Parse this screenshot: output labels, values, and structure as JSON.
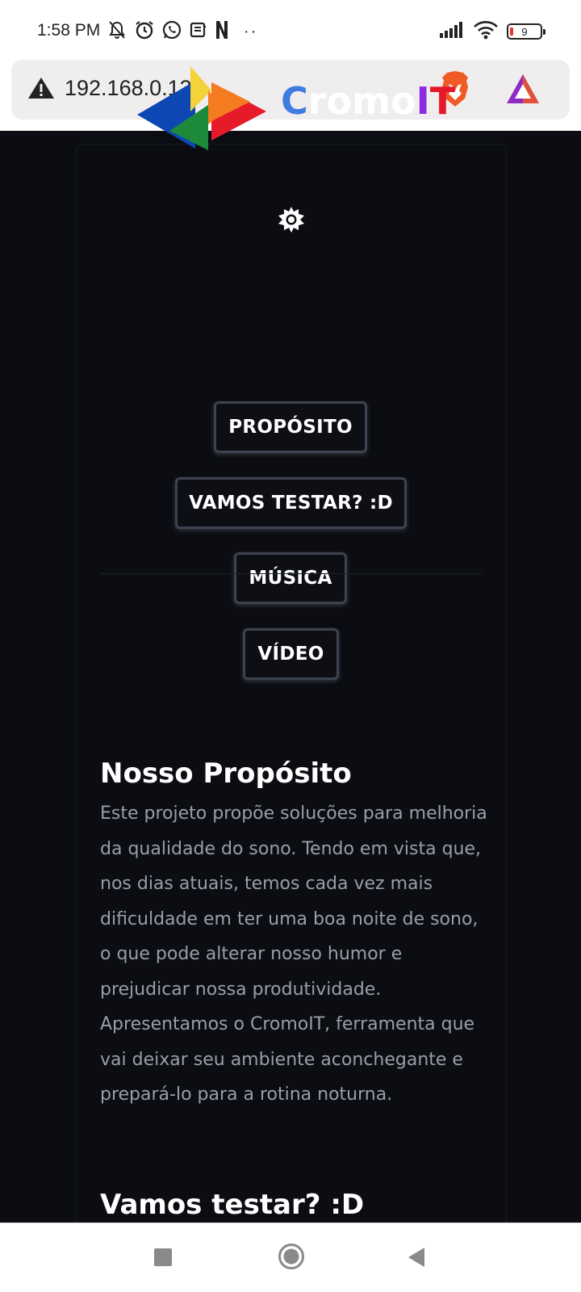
{
  "status_bar": {
    "time": "1:58 PM",
    "dots": "··",
    "battery_level": "9",
    "icons_left": [
      "muted-bell-icon",
      "alarm-icon",
      "whatsapp-icon",
      "news-icon",
      "netflix-icon"
    ],
    "icons_right": [
      "signal-icon",
      "wifi-icon",
      "battery-icon"
    ]
  },
  "browser": {
    "url": "192.168.0.138",
    "security_icon": "warning-icon",
    "icons": [
      "brave-lion-icon",
      "brave-rewards-icon"
    ]
  },
  "page": {
    "logo": {
      "text_parts": [
        "C",
        "romo",
        "I",
        "T"
      ],
      "colors": {
        "c": "#3f7be0",
        "romo": "#ffffff",
        "i": "#8b2be2",
        "t": "#e5192b"
      }
    },
    "theme_toggle_icon": "sun-icon",
    "nav_buttons": [
      "PROPÓSITO",
      "VAMOS TESTAR? :D",
      "MÚSICA",
      "VÍDEO"
    ],
    "sections": [
      {
        "title": "Nosso Propósito",
        "body": "Este projeto propõe soluções para melhoria da qualidade do sono. Tendo em vista que, nos dias atuais, temos cada vez mais dificuldade em ter uma boa noite de sono, o que pode alterar nosso humor e prejudicar nossa produtividade. Apresentamos o CromoIT, ferramenta que vai deixar seu ambiente aconchegante e prepará-lo para a rotina noturna."
      },
      {
        "title": "Vamos testar? :D"
      }
    ]
  },
  "nav_bar": {
    "buttons": [
      "recents-icon",
      "home-icon",
      "back-icon"
    ]
  },
  "colors": {
    "page_background": "#0b0d12",
    "button_border": "#3d4350",
    "body_text": "#9a9ea7"
  }
}
